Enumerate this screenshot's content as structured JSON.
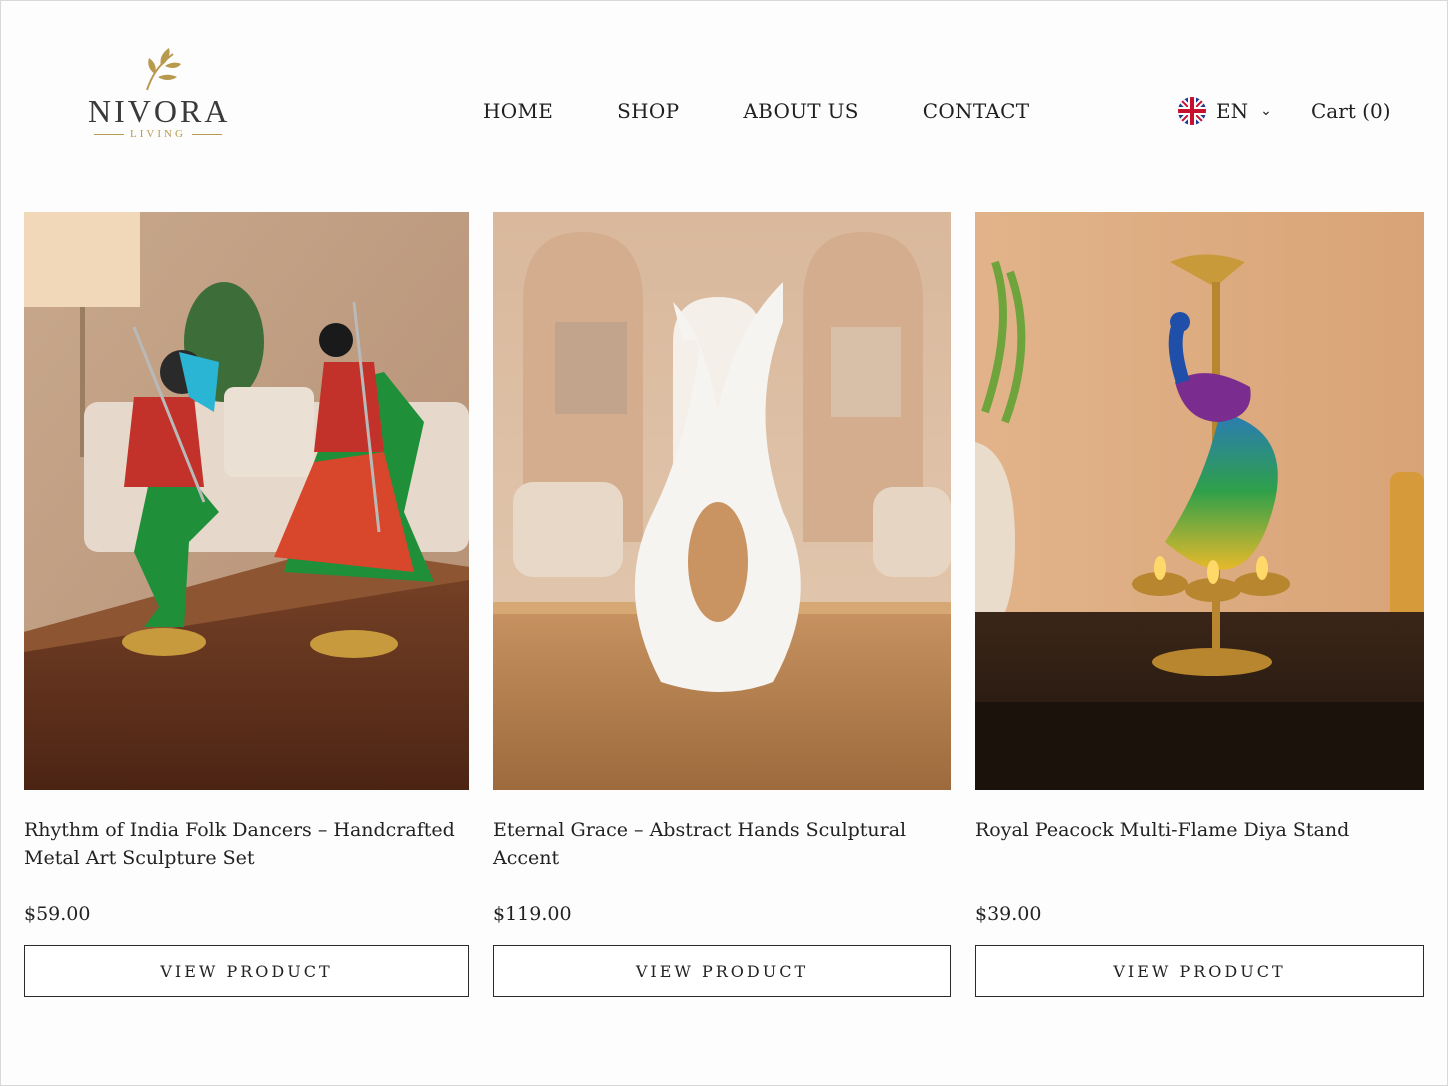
{
  "brand": {
    "name": "NIVORA",
    "tagline": "LIVING",
    "accent": "#b89a4e"
  },
  "nav": {
    "items": [
      "HOME",
      "SHOP",
      "ABOUT US",
      "CONTACT"
    ]
  },
  "language": {
    "code": "EN",
    "flag_icon": "uk-flag-icon"
  },
  "cart": {
    "label": "Cart (0)"
  },
  "products": [
    {
      "title": "Rhythm of India Folk Dancers – Handcrafted Metal Art Sculpture Set",
      "price": "$59.00",
      "button": "VIEW PRODUCT"
    },
    {
      "title": "Eternal Grace – Abstract Hands Sculptural Accent",
      "price": "$119.00",
      "button": "VIEW PRODUCT"
    },
    {
      "title": "Royal Peacock Multi-Flame Diya Stand",
      "price": "$39.00",
      "button": "VIEW PRODUCT"
    }
  ]
}
